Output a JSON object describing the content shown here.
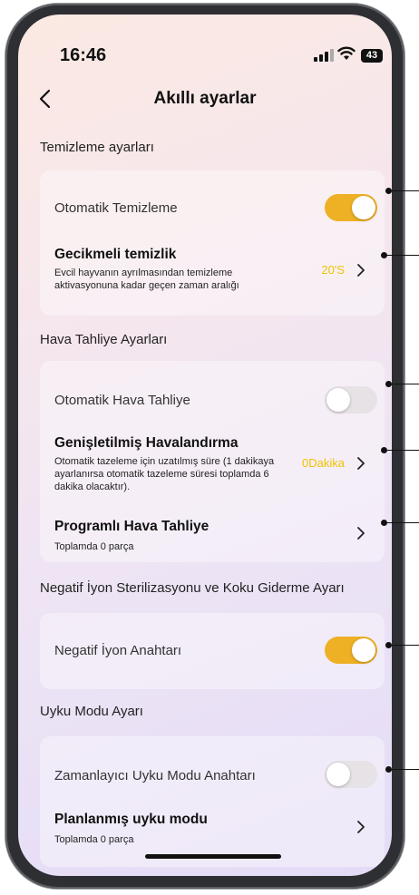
{
  "status": {
    "time": "16:46",
    "battery": "43"
  },
  "header": {
    "title": "Akıllı ayarlar"
  },
  "sections": [
    {
      "title": "Temizleme ayarları",
      "rows": [
        {
          "label": "Otomatik Temizleme",
          "control": "toggle",
          "on": true
        },
        {
          "label": "Gecikmeli temizlik",
          "desc": "Evcil hayvanın ayrılmasından temizleme aktivasyonuna kadar geçen zaman aralığı",
          "value": "20'S",
          "control": "chevron"
        }
      ]
    },
    {
      "title": "Hava Tahliye Ayarları",
      "rows": [
        {
          "label": "Otomatik Hava Tahliye",
          "control": "toggle",
          "on": false
        },
        {
          "label": "Genişletilmiş Havalandırma",
          "desc": "Otomatik tazeleme için uzatılmış süre (1 dakikaya ayarlanırsa otomatik tazeleme süresi toplamda 6 dakika olacaktır).",
          "value": "0Dakika",
          "control": "chevron"
        },
        {
          "label": "Programlı Hava Tahliye",
          "desc": "Toplamda 0 parça",
          "control": "chevron"
        }
      ]
    },
    {
      "title": "Negatif İyon Sterilizasyonu ve Koku Giderme Ayarı",
      "rows": [
        {
          "label": "Negatif İyon Anahtarı",
          "control": "toggle",
          "on": true
        }
      ]
    },
    {
      "title": "Uyku Modu Ayarı",
      "rows": [
        {
          "label": "Zamanlayıcı Uyku Modu Anahtarı",
          "control": "toggle",
          "on": false
        },
        {
          "label": "Planlanmış uyku modu",
          "desc": "Toplamda 0 parça",
          "control": "chevron"
        }
      ]
    }
  ],
  "colors": {
    "accent": "#eeb024",
    "value_text": "#f0c400",
    "toggle_off": "#e6e2e5"
  }
}
